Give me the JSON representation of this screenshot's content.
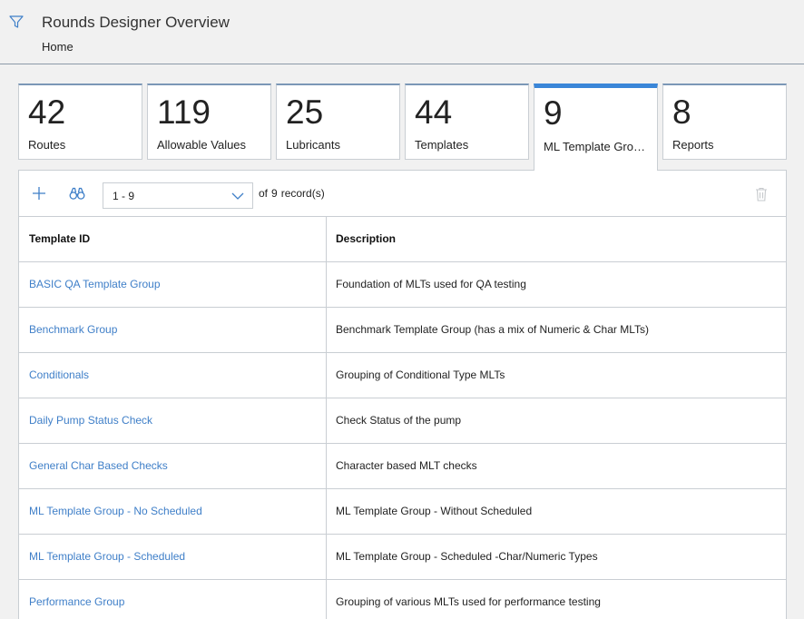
{
  "header": {
    "title": "Rounds Designer Overview",
    "breadcrumb": "Home"
  },
  "tiles": [
    {
      "count": "42",
      "label": "Routes",
      "active": false
    },
    {
      "count": "119",
      "label": "Allowable Values",
      "active": false
    },
    {
      "count": "25",
      "label": "Lubricants",
      "active": false
    },
    {
      "count": "44",
      "label": "Templates",
      "active": false
    },
    {
      "count": "9",
      "label": "ML Template Grou...",
      "active": true
    },
    {
      "count": "8",
      "label": "Reports",
      "active": false
    }
  ],
  "toolbar": {
    "range_value": "1 - 9",
    "of_label": "of",
    "total": "9",
    "records_label": "record(s)"
  },
  "table": {
    "columns": [
      "Template ID",
      "Description"
    ],
    "rows": [
      {
        "id": "BASIC QA Template Group",
        "description": "Foundation of MLTs used for QA testing"
      },
      {
        "id": "Benchmark Group",
        "description": "Benchmark Template Group (has a mix of Numeric & Char MLTs)"
      },
      {
        "id": "Conditionals",
        "description": "Grouping of Conditional Type MLTs"
      },
      {
        "id": "Daily Pump Status Check",
        "description": "Check Status of the pump"
      },
      {
        "id": "General Char Based Checks",
        "description": "Character based MLT checks"
      },
      {
        "id": "ML Template Group - No Scheduled",
        "description": "ML Template Group - Without Scheduled"
      },
      {
        "id": "ML Template Group - Scheduled",
        "description": "ML Template Group - Scheduled -Char/Numeric Types"
      },
      {
        "id": "Performance Group",
        "description": "Grouping of various MLTs used for performance testing"
      }
    ]
  },
  "colors": {
    "link": "#3f7fc8",
    "active_tab": "#3a86d8",
    "icon": "#3f7fc8"
  },
  "icons": [
    "filter-icon",
    "plus-icon",
    "binoculars-icon",
    "chevron-down-icon",
    "trash-icon"
  ]
}
